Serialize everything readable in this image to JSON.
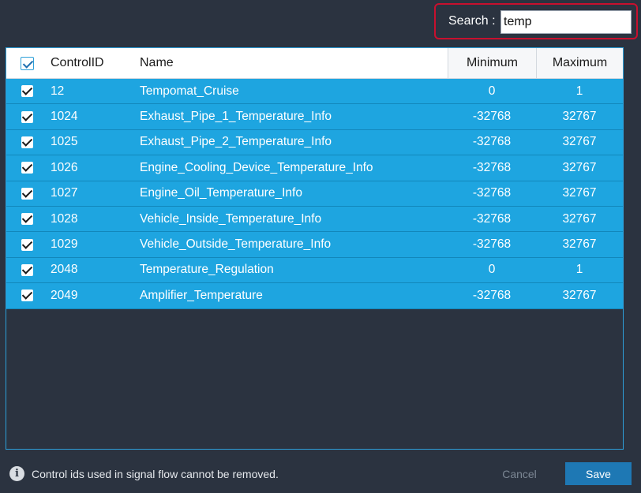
{
  "search": {
    "label": "Search :",
    "value": "temp"
  },
  "columns": {
    "control_id": "ControlID",
    "name": "Name",
    "minimum": "Minimum",
    "maximum": "Maximum"
  },
  "header_checked": true,
  "rows": [
    {
      "checked": true,
      "id": "12",
      "name": "Tempomat_Cruise",
      "min": "0",
      "max": "1"
    },
    {
      "checked": true,
      "id": "1024",
      "name": "Exhaust_Pipe_1_Temperature_Info",
      "min": "-32768",
      "max": "32767"
    },
    {
      "checked": true,
      "id": "1025",
      "name": "Exhaust_Pipe_2_Temperature_Info",
      "min": "-32768",
      "max": "32767"
    },
    {
      "checked": true,
      "id": "1026",
      "name": "Engine_Cooling_Device_Temperature_Info",
      "min": "-32768",
      "max": "32767"
    },
    {
      "checked": true,
      "id": "1027",
      "name": "Engine_Oil_Temperature_Info",
      "min": "-32768",
      "max": "32767"
    },
    {
      "checked": true,
      "id": "1028",
      "name": "Vehicle_Inside_Temperature_Info",
      "min": "-32768",
      "max": "32767"
    },
    {
      "checked": true,
      "id": "1029",
      "name": "Vehicle_Outside_Temperature_Info",
      "min": "-32768",
      "max": "32767"
    },
    {
      "checked": true,
      "id": "2048",
      "name": "Temperature_Regulation",
      "min": "0",
      "max": "1"
    },
    {
      "checked": true,
      "id": "2049",
      "name": "Amplifier_Temperature",
      "min": "-32768",
      "max": "32767"
    }
  ],
  "footer": {
    "info_icon": "info-icon",
    "info_text": "Control ids used in signal flow cannot be removed.",
    "cancel_label": "Cancel",
    "save_label": "Save"
  },
  "colors": {
    "background": "#2b3340",
    "row_selected": "#1ea5e0",
    "search_highlight": "#c8102e",
    "save_button": "#1e78b4"
  }
}
